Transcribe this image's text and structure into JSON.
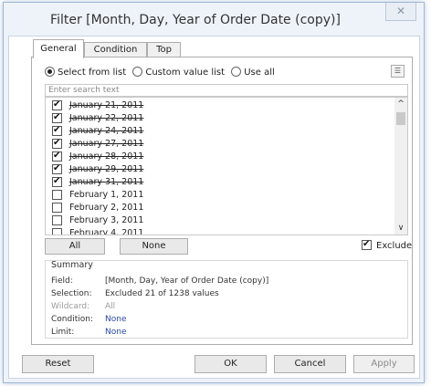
{
  "dialog": {
    "title": "Filter [Month, Day, Year of Order Date (copy)]",
    "close_label": "✕"
  },
  "tabs": [
    {
      "label": "General",
      "active": true
    },
    {
      "label": "Condition",
      "active": false
    },
    {
      "label": "Top",
      "active": false
    }
  ],
  "general": {
    "radio_options": [
      {
        "label": "Select from list",
        "selected": true
      },
      {
        "label": "Custom value list",
        "selected": false
      },
      {
        "label": "Use all",
        "selected": false
      }
    ],
    "search_placeholder": "Enter search text",
    "items": [
      {
        "label": "January 21, 2011",
        "checked": true,
        "struck": true
      },
      {
        "label": "January 22, 2011",
        "checked": true,
        "struck": true
      },
      {
        "label": "January 24, 2011",
        "checked": true,
        "struck": true
      },
      {
        "label": "January 27, 2011",
        "checked": true,
        "struck": true
      },
      {
        "label": "January 28, 2011",
        "checked": true,
        "struck": true
      },
      {
        "label": "January 29, 2011",
        "checked": true,
        "struck": true
      },
      {
        "label": "January 31, 2011",
        "checked": true,
        "struck": true
      },
      {
        "label": "February 1, 2011",
        "checked": false,
        "struck": false
      },
      {
        "label": "February 2, 2011",
        "checked": false,
        "struck": false
      },
      {
        "label": "February 3, 2011",
        "checked": false,
        "struck": false
      },
      {
        "label": "February 4, 2011",
        "checked": false,
        "struck": false
      }
    ],
    "all_label": "All",
    "none_label": "None",
    "exclude_label": "Exclude",
    "exclude_checked": true
  },
  "summary": {
    "title": "Summary",
    "rows": [
      {
        "label": "Field:",
        "value": "[Month, Day, Year of Order Date (copy)]",
        "style": "normal"
      },
      {
        "label": "Selection:",
        "value": "Excluded 21 of 1238 values",
        "style": "normal"
      },
      {
        "label": "Wildcard:",
        "value": "All",
        "style": "dim"
      },
      {
        "label": "Condition:",
        "value": "None",
        "style": "link"
      },
      {
        "label": "Limit:",
        "value": "None",
        "style": "link"
      }
    ]
  },
  "footer": {
    "reset_label": "Reset",
    "ok_label": "OK",
    "cancel_label": "Cancel",
    "apply_label": "Apply"
  },
  "icons": {
    "list_menu": "list-menu-icon",
    "scroll_up": "chevron-up-icon",
    "scroll_down": "chevron-down-icon",
    "close": "close-icon"
  },
  "colors": {
    "link": "#2a4aa8",
    "dim": "#9a9a9a",
    "frame": "#eef3fa"
  }
}
